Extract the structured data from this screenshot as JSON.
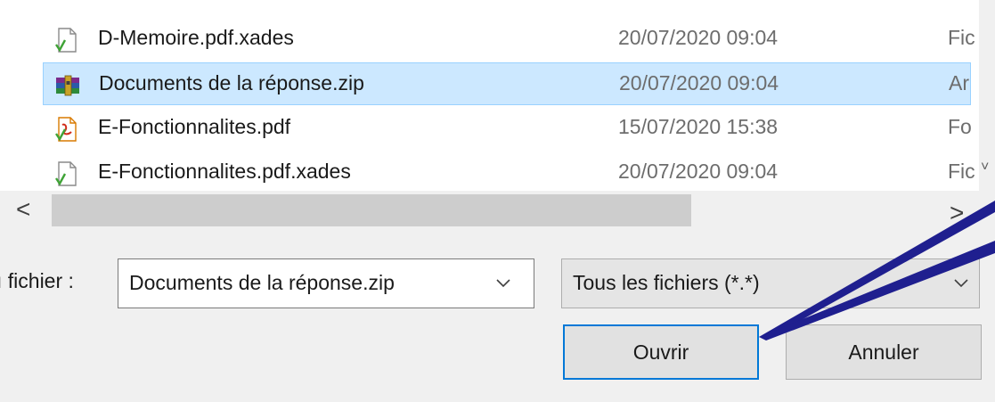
{
  "files": [
    {
      "name": "D-Memoire.pdf.xades",
      "date": "20/07/2020 09:04",
      "type": "Fic",
      "icon": "xades-file-icon",
      "selected": false
    },
    {
      "name": "Documents de la réponse.zip",
      "date": "20/07/2020 09:04",
      "type": "Ar",
      "icon": "winrar-archive-icon",
      "selected": true
    },
    {
      "name": "E-Fonctionnalites.pdf",
      "date": "15/07/2020 15:38",
      "type": "Fo",
      "icon": "pdf-file-icon",
      "selected": false
    },
    {
      "name": "E-Fonctionnalites.pdf.xades",
      "date": "20/07/2020 09:04",
      "type": "Fic",
      "icon": "xades-file-icon",
      "selected": false
    }
  ],
  "scrollbar": {
    "left_arrow": "<",
    "right_arrow": ">",
    "up_arrow": "˅"
  },
  "footer": {
    "filename_label": "ı fichier :",
    "filename_value": "Documents de la réponse.zip",
    "filetype_value": "Tous les fichiers (*.*)",
    "open_label": "Ouvrir",
    "cancel_label": "Annuler"
  },
  "colors": {
    "selection_bg": "#cce8ff",
    "selection_border": "#99d1ff",
    "default_button_border": "#0078d7",
    "annotation_arrow": "#1f1f8f"
  }
}
